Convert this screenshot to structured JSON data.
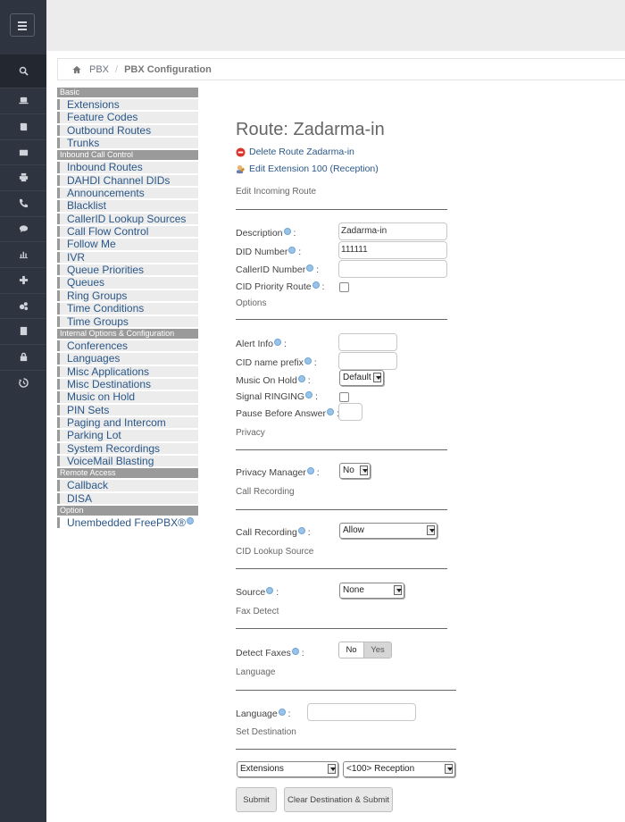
{
  "rail": {
    "icons": [
      "menu-icon",
      "search-icon",
      "laptop-icon",
      "book-icon",
      "envelope-icon",
      "print-icon",
      "phone-icon",
      "comments-icon",
      "chart-icon",
      "plus-icon",
      "cogs-icon",
      "building-icon",
      "lock-icon",
      "history-icon"
    ]
  },
  "breadcrumb": {
    "home": "PBX",
    "current": "PBX Configuration"
  },
  "nav": {
    "groups": [
      {
        "header": "Basic",
        "items": [
          "Extensions",
          "Feature Codes",
          "Outbound Routes",
          "Trunks"
        ]
      },
      {
        "header": "Inbound Call Control",
        "items": [
          "Inbound Routes",
          "DAHDI Channel DIDs",
          "Announcements",
          "Blacklist",
          "CallerID Lookup Sources",
          "Call Flow Control",
          "Follow Me",
          "IVR",
          "Queue Priorities",
          "Queues",
          "Ring Groups",
          "Time Conditions",
          "Time Groups"
        ]
      },
      {
        "header": "Internal Options & Configuration",
        "items": [
          "Conferences",
          "Languages",
          "Misc Applications",
          "Misc Destinations",
          "Music on Hold",
          "PIN Sets",
          "Paging and Intercom",
          "Parking Lot",
          "System Recordings",
          "VoiceMail Blasting"
        ]
      },
      {
        "header": "Remote Access",
        "items": [
          "Callback",
          "DISA"
        ]
      },
      {
        "header": "Option",
        "items": [
          "Unembedded FreePBX®"
        ]
      }
    ]
  },
  "main": {
    "title": "Route: Zadarma-in",
    "delete_link": "Delete Route Zadarma-in",
    "edit_ext_link": "Edit Extension 100 (Reception)",
    "sections": {
      "edit": "Edit Incoming Route",
      "options": "Options",
      "privacy": "Privacy",
      "call_recording": "Call Recording",
      "cid_lookup": "CID Lookup Source",
      "fax": "Fax Detect",
      "language": "Language",
      "destination": "Set Destination"
    },
    "fields": {
      "description": {
        "label": "Description",
        "value": "Zadarma-in"
      },
      "did": {
        "label": "DID Number",
        "value": "111111"
      },
      "cid_number": {
        "label": "CallerID Number",
        "value": ""
      },
      "cid_priority": {
        "label": "CID Priority Route"
      },
      "alert_info": {
        "label": "Alert Info",
        "value": ""
      },
      "cid_prefix": {
        "label": "CID name prefix",
        "value": ""
      },
      "moh": {
        "label": "Music On Hold",
        "value": "Default"
      },
      "signal_ringing": {
        "label": "Signal RINGING"
      },
      "pause": {
        "label": "Pause Before Answer",
        "value": ""
      },
      "privacy_mgr": {
        "label": "Privacy Manager",
        "value": "No"
      },
      "recording": {
        "label": "Call Recording",
        "value": "Allow"
      },
      "source": {
        "label": "Source",
        "value": "None"
      },
      "detect_fax": {
        "label": "Detect Faxes",
        "no": "No",
        "yes": "Yes"
      },
      "language": {
        "label": "Language",
        "value": ""
      },
      "dest_type": {
        "value": "Extensions"
      },
      "dest_target": {
        "value": "<100> Reception"
      }
    },
    "buttons": {
      "submit": "Submit",
      "clear": "Clear Destination & Submit"
    }
  }
}
